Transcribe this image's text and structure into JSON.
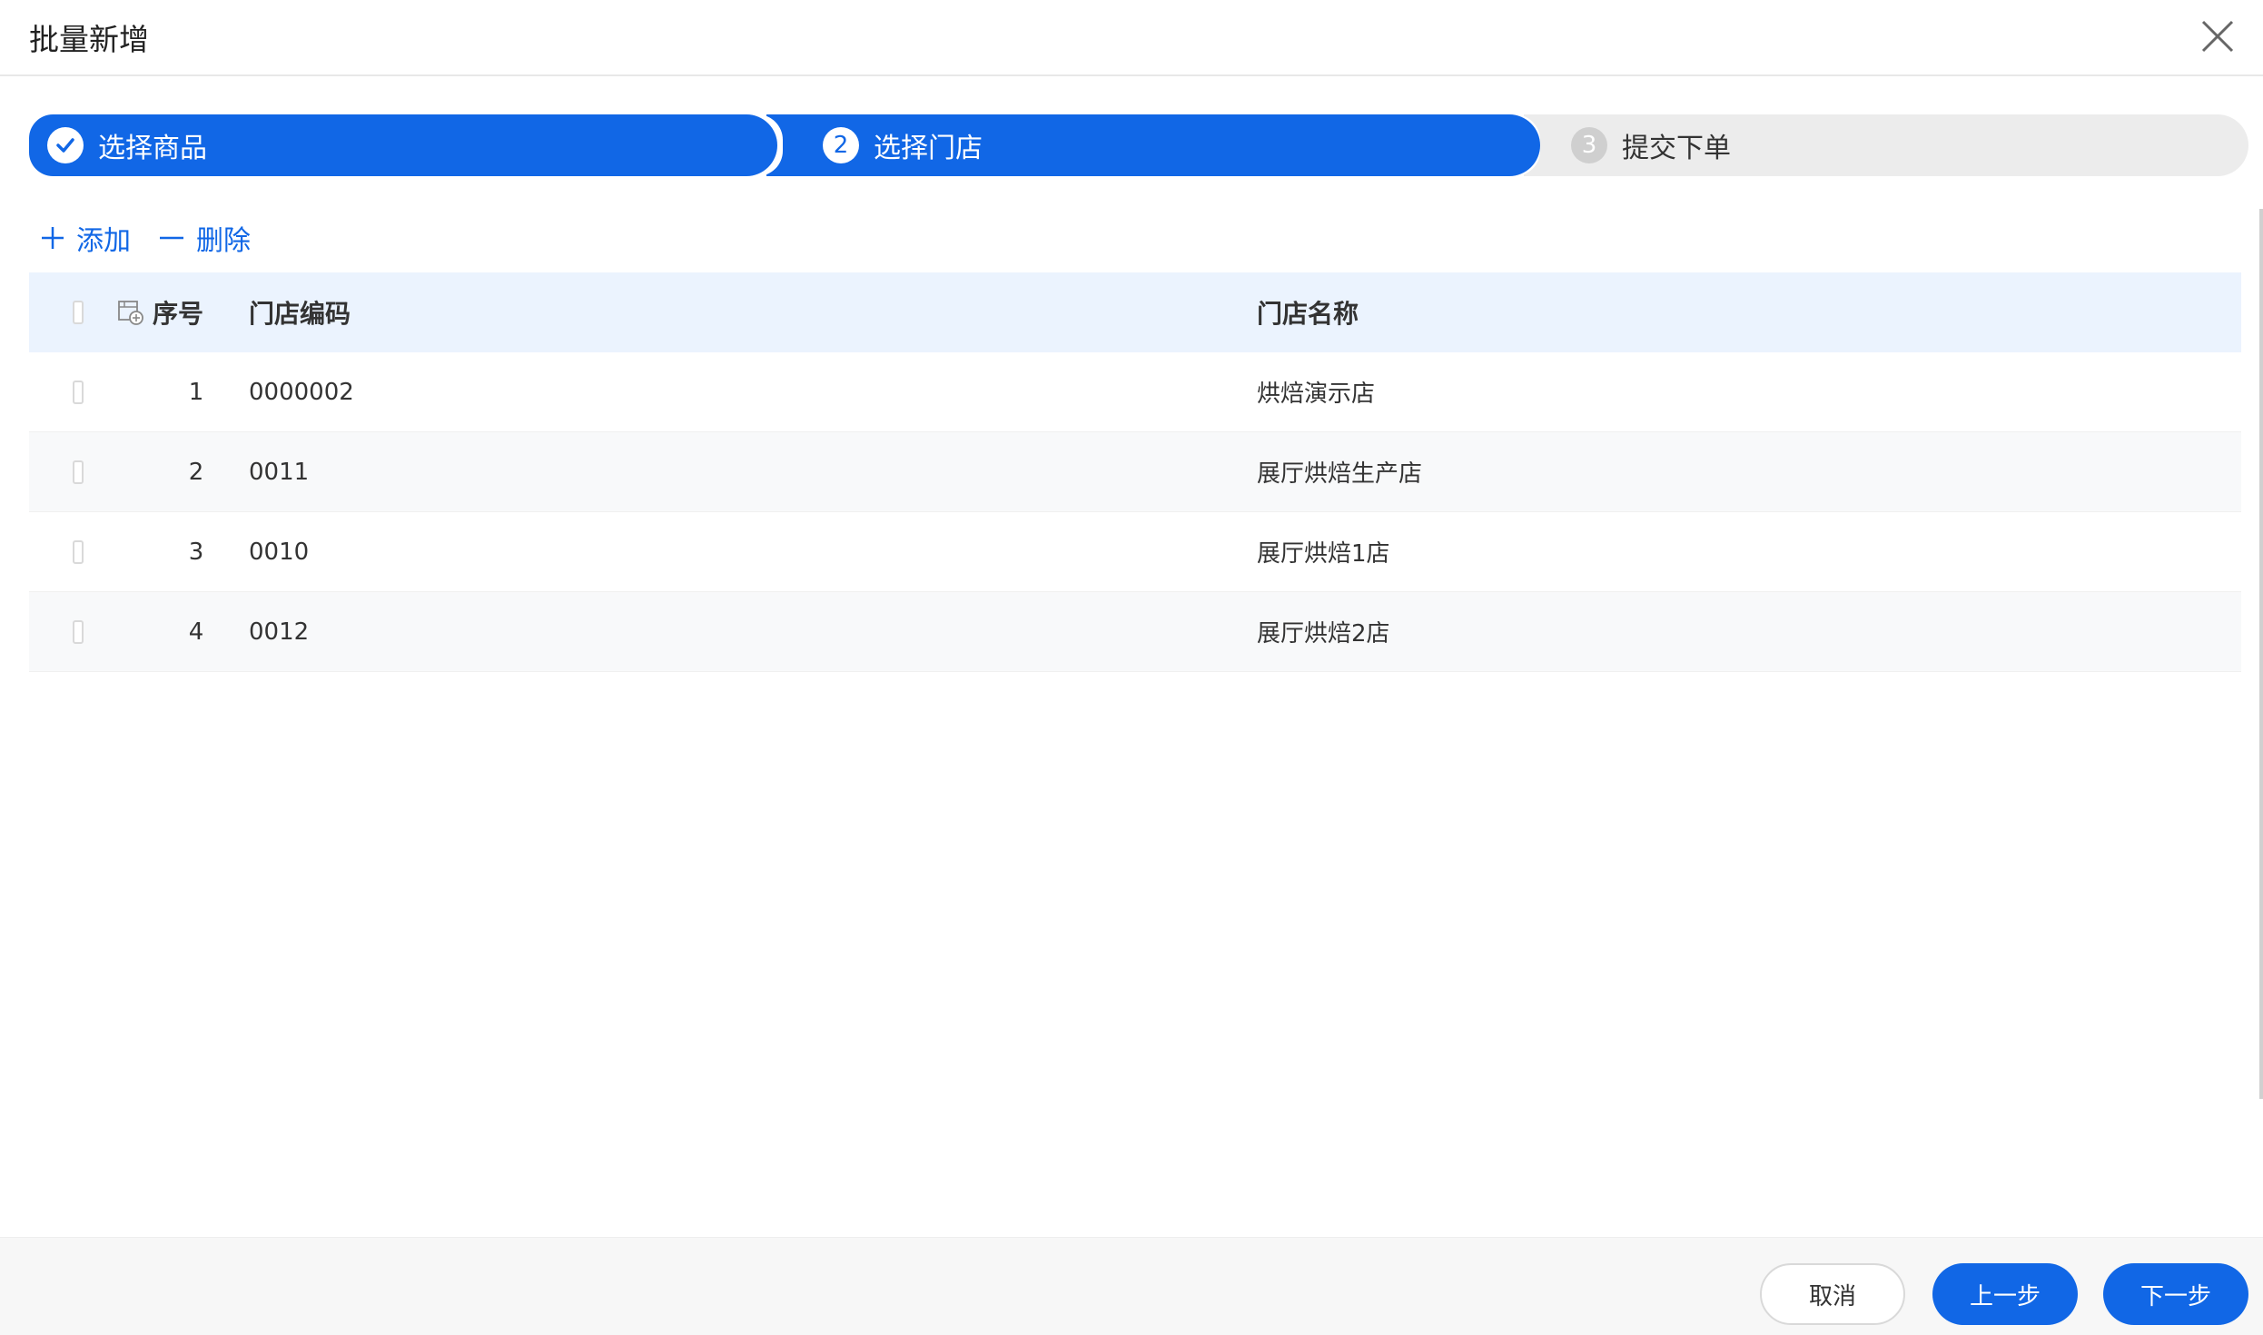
{
  "dialog": {
    "title": "批量新增"
  },
  "steps": [
    {
      "label": "选择商品",
      "status": "done"
    },
    {
      "number": "2",
      "label": "选择门店",
      "status": "active"
    },
    {
      "number": "3",
      "label": "提交下单",
      "status": "wait"
    }
  ],
  "toolbar": {
    "add_label": "添加",
    "delete_label": "删除"
  },
  "table": {
    "columns": {
      "seq": "序号",
      "code": "门店编码",
      "name": "门店名称"
    },
    "rows": [
      {
        "seq": "1",
        "code": "0000002",
        "name": "烘焙演示店"
      },
      {
        "seq": "2",
        "code": "0011",
        "name": "展厅烘焙生产店"
      },
      {
        "seq": "3",
        "code": "0010",
        "name": "展厅烘焙1店"
      },
      {
        "seq": "4",
        "code": "0012",
        "name": "展厅烘焙2店"
      }
    ]
  },
  "footer": {
    "cancel_label": "取消",
    "prev_label": "上一步",
    "next_label": "下一步"
  },
  "colors": {
    "primary": "#1167e6",
    "header_bg": "#ebf3fe",
    "step_wait_bg": "#ececec"
  },
  "icons": {
    "close": "close-icon",
    "check": "check-icon",
    "add": "plus-icon",
    "delete": "minus-icon",
    "column_setting": "column-setting-icon"
  }
}
